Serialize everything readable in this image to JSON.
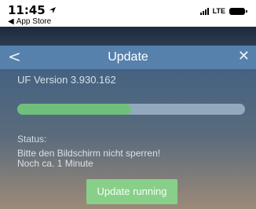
{
  "status_bar": {
    "time": "11:45",
    "back_label": "App Store",
    "network": "LTE"
  },
  "dialog": {
    "title": "Update",
    "version": "UF Version 3.930.162",
    "progress": 0.5,
    "status_label": "Status:",
    "status_line1": "Bitte den Bildschirm nicht sperren!",
    "status_line2": "Noch ca. 1 Minute",
    "button_label": "Update running"
  },
  "colors": {
    "progress_fill": "#6fc07b",
    "progress_track": "#93a9bd",
    "button": "#88cf8a",
    "header": "#5f8cb9"
  }
}
